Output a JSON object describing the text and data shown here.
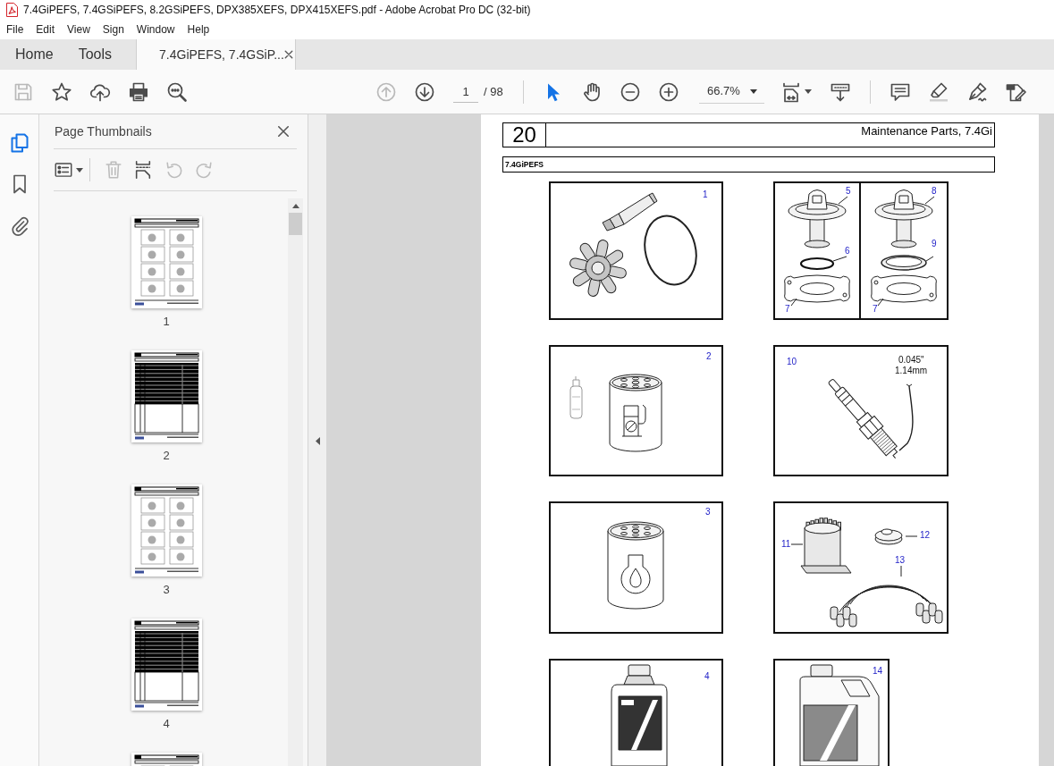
{
  "window": {
    "title": "7.4GiPEFS, 7.4GSiPEFS, 8.2GSiPEFS, DPX385XEFS, DPX415XEFS.pdf - Adobe Acrobat Pro DC (32-bit)"
  },
  "menu": [
    "File",
    "Edit",
    "View",
    "Sign",
    "Window",
    "Help"
  ],
  "tabs": [
    {
      "label": "Home",
      "kind": "app",
      "selected": false
    },
    {
      "label": "Tools",
      "kind": "app",
      "selected": false
    },
    {
      "label": "7.4GiPEFS, 7.4GSiP...",
      "kind": "document",
      "selected": true
    }
  ],
  "toolbar": {
    "save": {
      "disabled": true
    },
    "previous_page": {
      "disabled": true
    },
    "next_page": {
      "disabled": false
    },
    "page_number": "1",
    "page_count": "/ 98",
    "select_tool": {
      "selected": true
    },
    "hand_tool": {
      "selected": false
    },
    "zoom": "66.7%"
  },
  "sidebar": {
    "rail": [
      {
        "kind": "pages",
        "selected": true
      },
      {
        "kind": "bookmarks",
        "selected": false
      },
      {
        "kind": "attachments",
        "selected": false
      }
    ],
    "panel": {
      "title": "Page Thumbnails",
      "delete": {
        "disabled": true
      },
      "rotate_left": {
        "disabled": true
      },
      "rotate_right": {
        "disabled": true
      },
      "thumbnails": [
        {
          "kind": "figures",
          "label": "1"
        },
        {
          "kind": "table",
          "label": "2"
        },
        {
          "kind": "figures",
          "label": "3"
        },
        {
          "kind": "table",
          "label": "4"
        },
        {
          "kind": "figures"
        }
      ]
    }
  },
  "page": {
    "section_number": "20",
    "section_title": "Maintenance Parts, 7.4Gi",
    "model": "7.4GiPEFS",
    "figures": [
      {
        "kind": "impeller_kit",
        "callouts": [
          "1"
        ]
      },
      {
        "kind": "thermostats",
        "callouts": [
          "5",
          "6",
          "7",
          "8",
          "9",
          "7"
        ]
      },
      {
        "kind": "fuel_filter",
        "callouts": [
          "2"
        ]
      },
      {
        "kind": "spark_plug",
        "callouts": [
          "10"
        ],
        "gap_inch": "0.045\"",
        "gap_mm": "1.14mm"
      },
      {
        "kind": "oil_filter",
        "callouts": [
          "3"
        ]
      },
      {
        "kind": "ignition_parts",
        "callouts": [
          "11",
          "12",
          "13"
        ]
      },
      {
        "kind": "oil_bottle",
        "callouts": [
          "4"
        ]
      },
      {
        "kind": "coolant_jug",
        "callouts": [
          "14"
        ]
      }
    ]
  }
}
